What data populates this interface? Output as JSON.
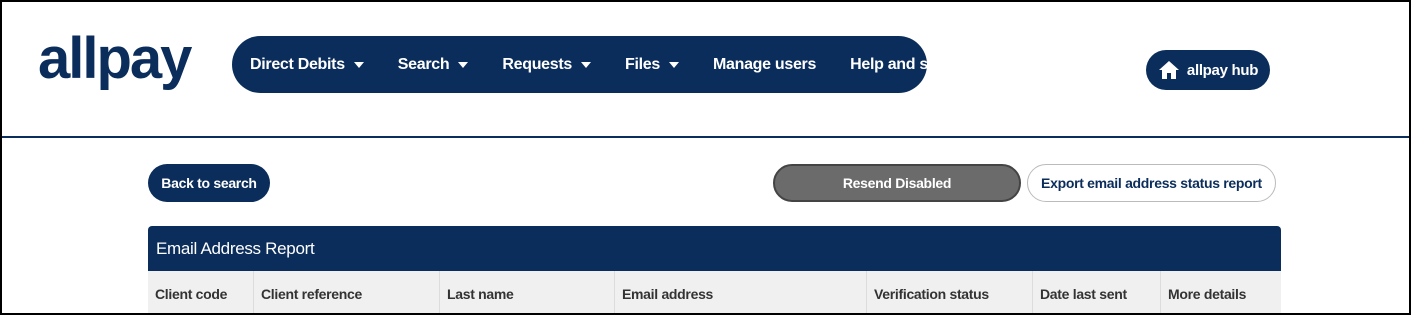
{
  "brand": {
    "logo_text": "allpay"
  },
  "nav": {
    "items": [
      {
        "label": "Direct Debits",
        "dropdown": true
      },
      {
        "label": "Search",
        "dropdown": true
      },
      {
        "label": "Requests",
        "dropdown": true
      },
      {
        "label": "Files",
        "dropdown": true
      },
      {
        "label": "Manage users",
        "dropdown": false
      },
      {
        "label": "Help and support",
        "dropdown": false
      }
    ]
  },
  "hub": {
    "label": "allpay hub",
    "icon": "home-icon"
  },
  "actions": {
    "back_label": "Back to search",
    "resend_label": "Resend Disabled",
    "export_label": "Export email address status report"
  },
  "report": {
    "title": "Email Address Report",
    "columns": [
      "Client code",
      "Client reference",
      "Last name",
      "Email address",
      "Verification status",
      "Date last sent",
      "More details"
    ]
  },
  "colors": {
    "brand_navy": "#0b2d5b",
    "disabled_gray": "#6b6b6b"
  }
}
